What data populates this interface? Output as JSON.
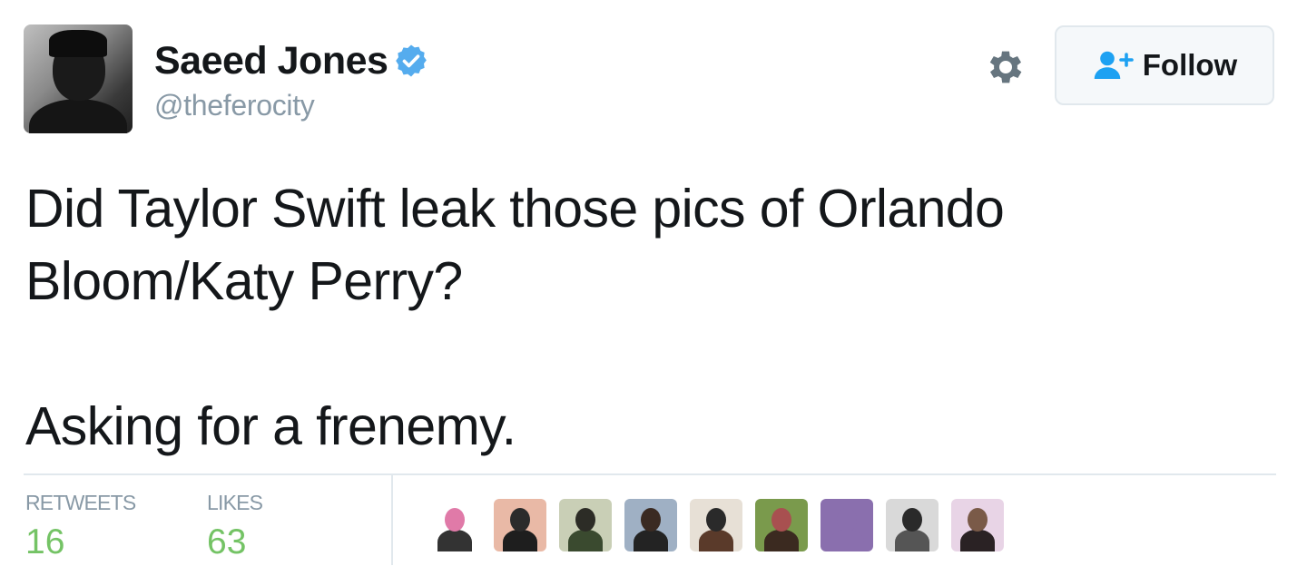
{
  "author": {
    "display_name": "Saeed Jones",
    "handle": "@theferocity",
    "verified": true,
    "avatar_icon": "profile-photo"
  },
  "actions": {
    "settings_icon": "gear-icon",
    "follow_icon": "add-user-icon",
    "follow_label": "Follow"
  },
  "tweet": {
    "paragraphs": [
      "Did Taylor Swift leak those pics of Orlando Bloom/Katy Perry?",
      "Asking for a frenemy."
    ]
  },
  "stats": {
    "retweets_label": "RETWEETS",
    "retweets_count": "16",
    "likes_label": "LIKES",
    "likes_count": "63"
  },
  "likers": [
    {
      "name": "liker-avatar-1",
      "bg": "#ffffff",
      "fig": "#e07aa8",
      "body": "#333333"
    },
    {
      "name": "liker-avatar-2",
      "bg": "#e9b9a6",
      "fig": "#2b2b2b",
      "body": "#1e1e1e"
    },
    {
      "name": "liker-avatar-3",
      "bg": "#c9cfb6",
      "fig": "#2c2c26",
      "body": "#3a4a2f"
    },
    {
      "name": "liker-avatar-4",
      "bg": "#9fb0c4",
      "fig": "#3a2a22",
      "body": "#232323"
    },
    {
      "name": "liker-avatar-5",
      "bg": "#e7e0d6",
      "fig": "#2a2a2a",
      "body": "#5a3a2a"
    },
    {
      "name": "liker-avatar-6",
      "bg": "#7a9a4c",
      "fig": "#a85050",
      "body": "#3b2a20"
    },
    {
      "name": "liker-avatar-7",
      "bg": "#8a6fae",
      "fig": "#8a6fae",
      "body": "#8a6fae"
    },
    {
      "name": "liker-avatar-8",
      "bg": "#d9d9d9",
      "fig": "#2a2a2a",
      "body": "#555555"
    },
    {
      "name": "liker-avatar-9",
      "bg": "#e8d4e6",
      "fig": "#7a5a48",
      "body": "#2a2224"
    }
  ],
  "colors": {
    "accent": "#1da1f2",
    "verified": "#55acee",
    "stat_value": "#74c365",
    "muted": "#8899a6",
    "divider": "#e1e8ed"
  }
}
